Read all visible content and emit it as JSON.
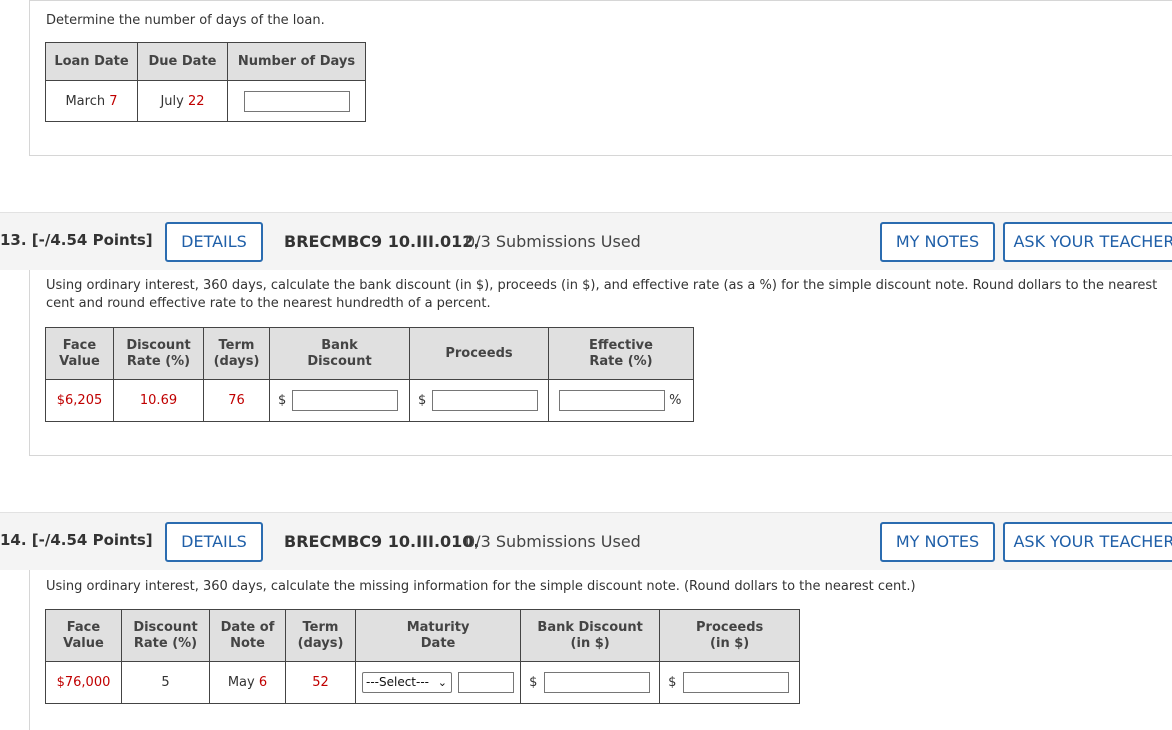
{
  "q12": {
    "text": "Determine the number of days of the loan.",
    "headers": [
      "Loan Date",
      "Due Date",
      "Number of Days"
    ],
    "row": {
      "loan_month": "March",
      "loan_day": "7",
      "due_month": "July",
      "due_day": "22"
    }
  },
  "q13": {
    "number": "13.  [-/4.54 Points]",
    "details": "DETAILS",
    "code": "BRECMBC9 10.III.012.",
    "submissions": "0/3 Submissions Used",
    "my_notes": "MY NOTES",
    "ask": "ASK YOUR TEACHER",
    "text_line1": "Using ordinary interest, 360 days, calculate the bank discount (in $), proceeds (in $), and effective rate (as a %) for the simple discount note. Round dollars to the nearest",
    "text_line2": "cent and round effective rate to the nearest hundredth of a percent.",
    "h_face1": "Face",
    "h_face2": "Value",
    "h_disc1": "Discount",
    "h_disc2": "Rate (%)",
    "h_term1": "Term",
    "h_term2": "(days)",
    "h_bank1": "Bank",
    "h_bank2": "Discount",
    "h_proc": "Proceeds",
    "h_eff1": "Effective",
    "h_eff2": "Rate (%)",
    "face": "$6,205",
    "rate": "10.69",
    "term": "76",
    "dollar": "$",
    "percent": "%"
  },
  "q14": {
    "number": "14.  [-/4.54 Points]",
    "details": "DETAILS",
    "code": "BRECMBC9 10.III.010.",
    "submissions": "0/3 Submissions Used",
    "my_notes": "MY NOTES",
    "ask": "ASK YOUR TEACHER",
    "text": "Using ordinary interest, 360 days, calculate the missing information for the simple discount note. (Round dollars to the nearest cent.)",
    "h_face1": "Face",
    "h_face2": "Value",
    "h_disc1": "Discount",
    "h_disc2": "Rate (%)",
    "h_date1": "Date of",
    "h_date2": "Note",
    "h_term1": "Term",
    "h_term2": "(days)",
    "h_mat1": "Maturity",
    "h_mat2": "Date",
    "h_bank1": "Bank Discount",
    "h_bank2": "(in $)",
    "h_proc1": "Proceeds",
    "h_proc2": "(in $)",
    "face": "$76,000",
    "rate": "5",
    "date_month": "May",
    "date_day": "6",
    "term": "52",
    "select_value": "---Select---",
    "dollar": "$"
  }
}
